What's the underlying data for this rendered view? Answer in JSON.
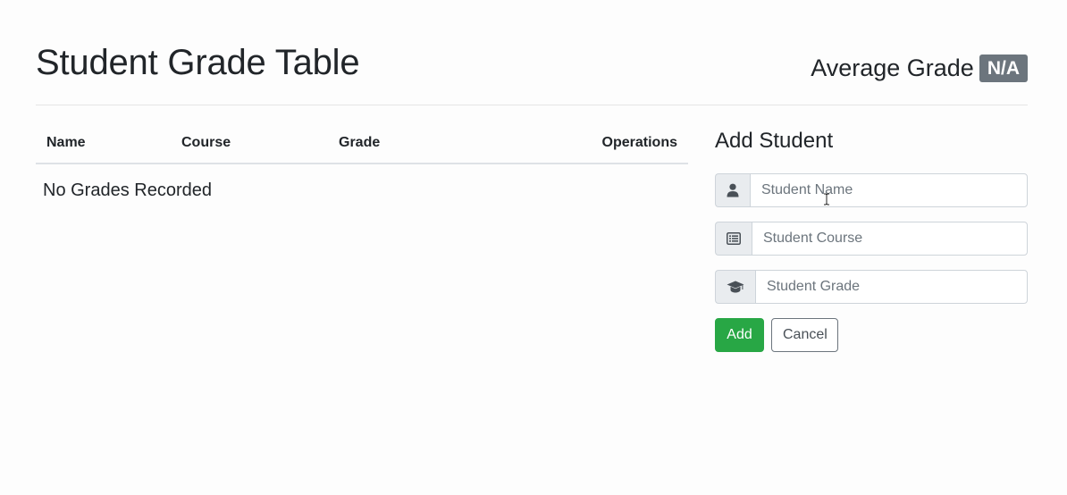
{
  "header": {
    "title": "Student Grade Table",
    "average_label": "Average Grade",
    "average_value": "N/A"
  },
  "table": {
    "columns": [
      "Name",
      "Course",
      "Grade",
      "Operations"
    ],
    "rows": [],
    "empty_message": "No Grades Recorded"
  },
  "form": {
    "heading": "Add Student",
    "fields": [
      {
        "icon": "user-icon",
        "placeholder": "Student Name",
        "value": ""
      },
      {
        "icon": "list-icon",
        "placeholder": "Student Course",
        "value": ""
      },
      {
        "icon": "graduation-cap-icon",
        "placeholder": "Student Grade",
        "value": ""
      }
    ],
    "add_label": "Add",
    "cancel_label": "Cancel"
  },
  "colors": {
    "badge": "#6c757d",
    "add_button": "#28a745",
    "addon_bg": "#e9ecef",
    "border": "#ced4da"
  }
}
